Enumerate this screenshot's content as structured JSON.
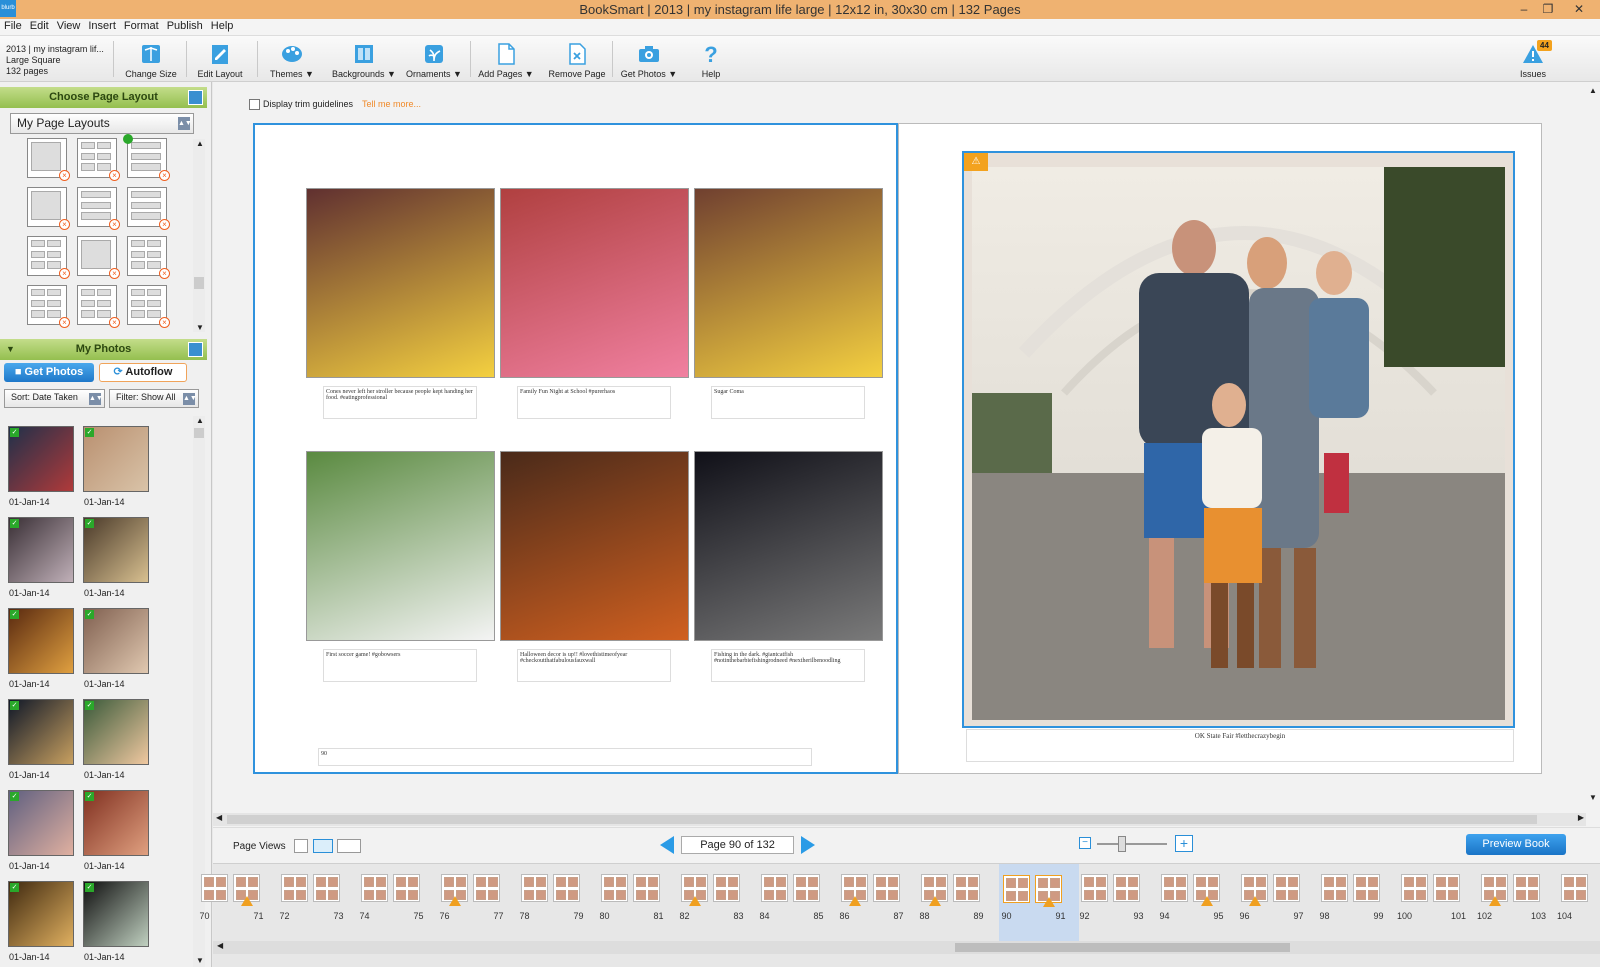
{
  "window": {
    "title": "BookSmart  |  2013 | my instagram life large  |  12x12 in, 30x30 cm  |  132 Pages",
    "app_icon_label": "blurb"
  },
  "menu": [
    "File",
    "Edit",
    "View",
    "Insert",
    "Format",
    "Publish",
    "Help"
  ],
  "book": {
    "name": "2013 | my instagram lif...",
    "size": "Large Square",
    "pages": "132 pages"
  },
  "toolbar": [
    {
      "label": "Change Size",
      "icon": "book-size-icon"
    },
    {
      "label": "Edit Layout",
      "icon": "edit-layout-icon"
    },
    {
      "label": "Themes ▼",
      "icon": "themes-palette-icon"
    },
    {
      "label": "Backgrounds ▼",
      "icon": "backgrounds-icon"
    },
    {
      "label": "Ornaments ▼",
      "icon": "ornaments-icon"
    },
    {
      "label": "Add Pages ▼",
      "icon": "add-page-icon"
    },
    {
      "label": "Remove Page",
      "icon": "remove-page-icon"
    },
    {
      "label": "Get Photos ▼",
      "icon": "camera-icon"
    },
    {
      "label": "Help",
      "icon": "help-icon"
    }
  ],
  "issues": {
    "label": "Issues",
    "count": "44"
  },
  "layout_panel": {
    "title": "Choose Page Layout",
    "dropdown": "My Page Layouts"
  },
  "photos_panel": {
    "title": "My Photos",
    "get_photos": "Get Photos",
    "autoflow": "Autoflow",
    "sort": "Sort:  Date Taken",
    "filter": "Filter: Show All",
    "photos": [
      {
        "date": "01-Jan-14",
        "colors": [
          "#20304a",
          "#b03a3a"
        ]
      },
      {
        "date": "01-Jan-14",
        "colors": [
          "#b99070",
          "#d9c3a8"
        ]
      },
      {
        "date": "01-Jan-14",
        "colors": [
          "#3a3036",
          "#c0b0b8"
        ]
      },
      {
        "date": "01-Jan-14",
        "colors": [
          "#4a3a2a",
          "#d8c090"
        ]
      },
      {
        "date": "01-Jan-14",
        "colors": [
          "#5a2a10",
          "#e0a040"
        ]
      },
      {
        "date": "01-Jan-14",
        "colors": [
          "#806050",
          "#e0c8b0"
        ]
      },
      {
        "date": "01-Jan-14",
        "colors": [
          "#101828",
          "#c8a060"
        ]
      },
      {
        "date": "01-Jan-14",
        "colors": [
          "#3a5a3a",
          "#f0c8a0"
        ]
      },
      {
        "date": "01-Jan-14",
        "colors": [
          "#606080",
          "#e0b0a0"
        ]
      },
      {
        "date": "01-Jan-14",
        "colors": [
          "#803020",
          "#e0a080"
        ]
      },
      {
        "date": "01-Jan-14",
        "colors": [
          "#402a10",
          "#e0b060"
        ]
      },
      {
        "date": "01-Jan-14",
        "colors": [
          "#101010",
          "#c0d0c0"
        ]
      }
    ]
  },
  "workspace": {
    "trim_label": "Display trim guidelines",
    "tell_more": "Tell me more...",
    "left_captions": [
      "Cones never left her stroller because people kept handing her food. #eatingprofessional",
      "Family Fun Night at School #purerhaos",
      "Sugar Coma",
      "First soccer game! #gobowsers",
      "Halloween decor is up!! #lovethistimeofyear #checkoutthatfabulousfauxwall",
      "Fishing in the dark. #giantcatfish #notinthebarbiefishingrodneed #nextherilbenoodling"
    ],
    "page_number": "90",
    "right_caption": "OK State Fair #letthecrazybegin"
  },
  "nav": {
    "page_views": "Page Views",
    "page_indicator": "Page 90 of 132",
    "preview": "Preview Book"
  },
  "filmstrip": [
    [
      "70",
      "71"
    ],
    [
      "72",
      "73"
    ],
    [
      "74",
      "75"
    ],
    [
      "76",
      "77"
    ],
    [
      "78",
      "79"
    ],
    [
      "80",
      "81"
    ],
    [
      "82",
      "83"
    ],
    [
      "84",
      "85"
    ],
    [
      "86",
      "87"
    ],
    [
      "88",
      "89"
    ],
    [
      "90",
      "91"
    ],
    [
      "92",
      "93"
    ],
    [
      "94",
      "95"
    ],
    [
      "96",
      "97"
    ],
    [
      "98",
      "99"
    ],
    [
      "100",
      "101"
    ],
    [
      "102",
      "103"
    ],
    [
      "104"
    ]
  ]
}
